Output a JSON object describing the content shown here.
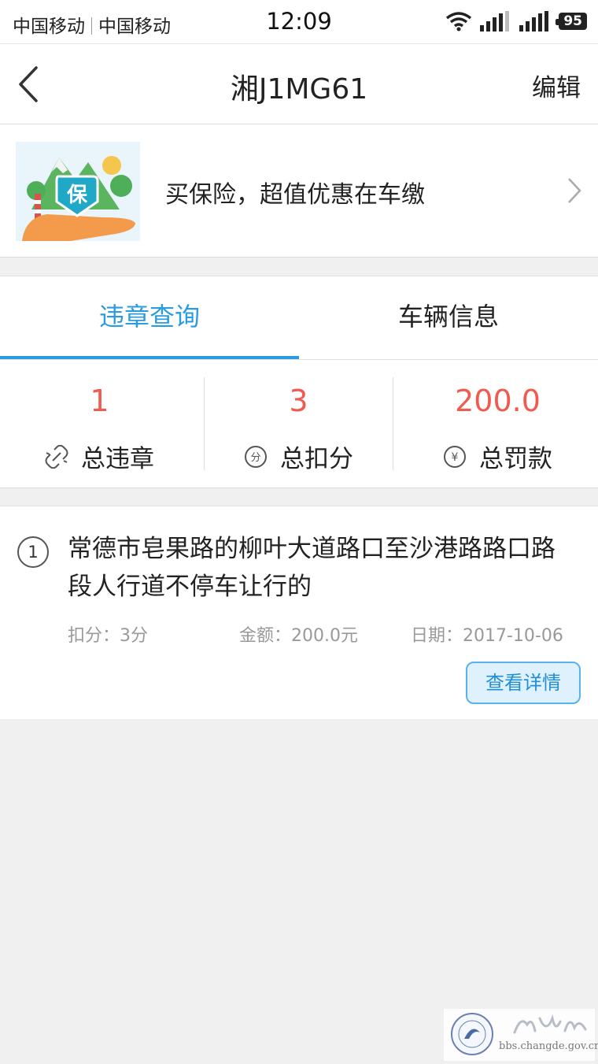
{
  "status_bar": {
    "carrier_1": "中国移动",
    "carrier_2": "中国移动",
    "time": "12:09",
    "battery": "95"
  },
  "nav": {
    "title": "湘J1MG61",
    "edit_label": "编辑"
  },
  "banner": {
    "text": "买保险，超值优惠在车缴",
    "badge_char": "保"
  },
  "tabs": [
    {
      "label": "违章查询",
      "active": true
    },
    {
      "label": "车辆信息",
      "active": false
    }
  ],
  "stats": [
    {
      "value": "1",
      "label": "总违章",
      "icon": "broken-link-icon"
    },
    {
      "value": "3",
      "label": "总扣分",
      "icon": "points-icon",
      "icon_char": "分"
    },
    {
      "value": "200.0",
      "label": "总罚款",
      "icon": "yuan-icon",
      "icon_char": "¥"
    }
  ],
  "records": [
    {
      "index": "1",
      "title": "常德市皂果路的柳叶大道路口至沙港路路口路段人行道不停车让行的",
      "points": "扣分：3分",
      "amount": "金额：200.0元",
      "date": "日期：2017-10-06",
      "detail_label": "查看详情"
    }
  ],
  "watermark": {
    "text": "bbs.changde.gov.cn",
    "script_text": "常德论坛"
  },
  "colors": {
    "accent_blue": "#2a9be0",
    "stat_red": "#f05a4f",
    "background": "#f0f0f0"
  }
}
